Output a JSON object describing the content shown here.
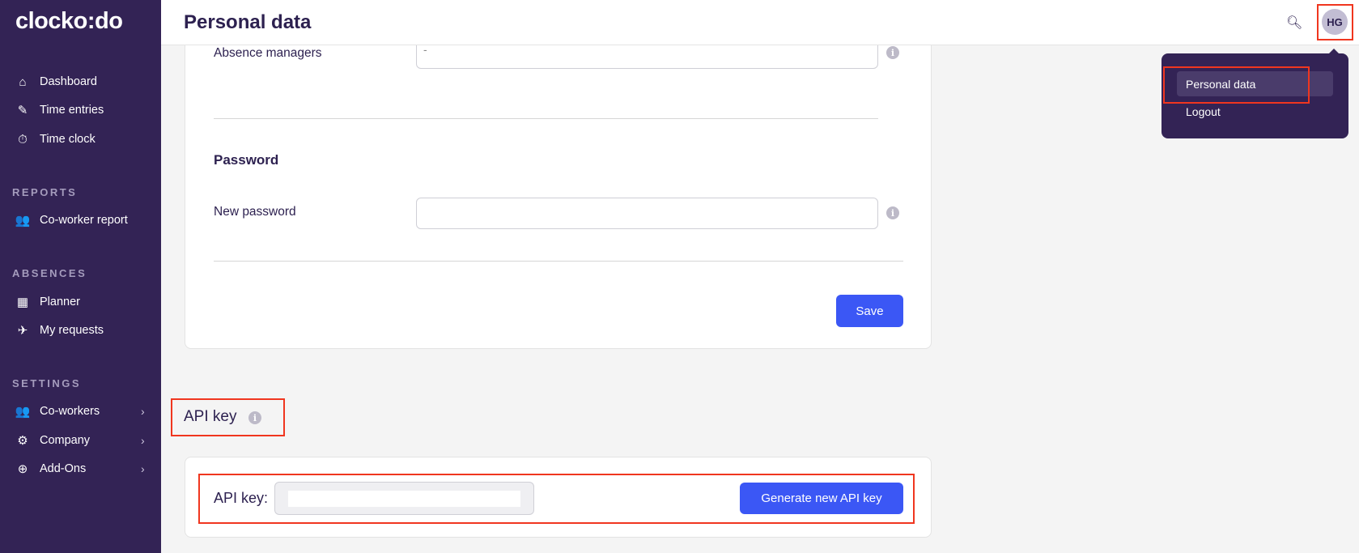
{
  "app": {
    "logo": "clocko:do"
  },
  "sidebar": {
    "main": [
      {
        "label": "Dashboard",
        "icon": "home-icon"
      },
      {
        "label": "Time entries",
        "icon": "edit-icon"
      },
      {
        "label": "Time clock",
        "icon": "stopwatch-icon"
      }
    ],
    "reports_title": "REPORTS",
    "reports": [
      {
        "label": "Co-worker report",
        "icon": "users-icon"
      }
    ],
    "absences_title": "ABSENCES",
    "absences": [
      {
        "label": "Planner",
        "icon": "calendar-icon"
      },
      {
        "label": "My requests",
        "icon": "plane-icon"
      }
    ],
    "settings_title": "SETTINGS",
    "settings": [
      {
        "label": "Co-workers",
        "icon": "users-icon"
      },
      {
        "label": "Company",
        "icon": "gear-icon"
      },
      {
        "label": "Add-Ons",
        "icon": "plus-circle-icon"
      }
    ]
  },
  "header": {
    "title": "Personal data",
    "avatar": "HG"
  },
  "user_menu": {
    "items": [
      "Personal data",
      "Logout"
    ]
  },
  "form": {
    "absence_managers_label": "Absence managers",
    "absence_managers_value": "-",
    "password_heading": "Password",
    "new_password_label": "New password",
    "new_password_value": "",
    "save_label": "Save"
  },
  "api": {
    "heading": "API key",
    "label": "API key:",
    "value": "",
    "generate_label": "Generate new API key"
  },
  "colors": {
    "sidebar": "#332355",
    "accent": "#3b57f5",
    "highlight": "#f0361f"
  }
}
